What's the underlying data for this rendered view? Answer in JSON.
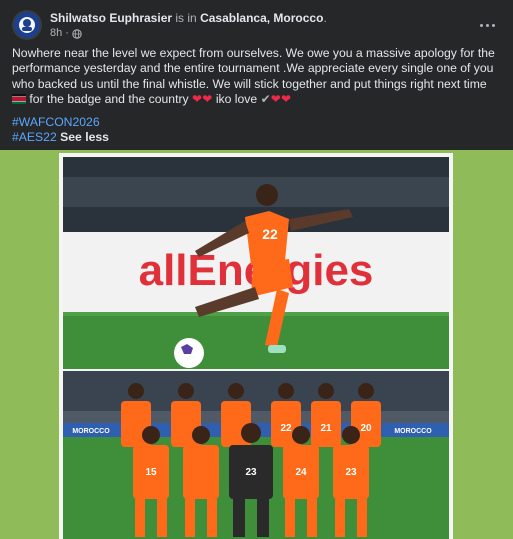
{
  "post": {
    "author": "Shilwatso Euphrasier",
    "verb": " is in ",
    "location": "Casablanca, Morocco",
    "period": ".",
    "time": "8h",
    "text_main": "Nowhere near the level we expect from ourselves. We owe you a massive apology for the performance yesterday and the entire tournament .We appreciate every single one of you who backed us until the final whistle. We will stick together and put things right next time",
    "text_tail_1": " for the badge and the country ",
    "text_tail_2": " iko love ",
    "hashtag_1": "#WAFCON2026",
    "hashtag_2": "#AES22",
    "see_less": "See less"
  },
  "photo1": {
    "ad_board": "allEnergies",
    "jersey_number": "22"
  },
  "photo2": {
    "ad_left": "MOROCCO",
    "ad_right": "MOROCCO",
    "back_numbers": [
      "",
      "",
      "",
      "22",
      "21",
      "20"
    ],
    "front_numbers": [
      "15",
      "",
      "23",
      "24",
      "23"
    ]
  },
  "colors": {
    "background": "#252728",
    "link": "#5aa7ff",
    "heart": "#f02849",
    "media_bg": "#8fbb59",
    "jersey": "#ff6a1a"
  },
  "icons": [
    "globe-icon",
    "more-options-icon",
    "kenya-flag-icon",
    "heart-icon",
    "check-icon"
  ]
}
